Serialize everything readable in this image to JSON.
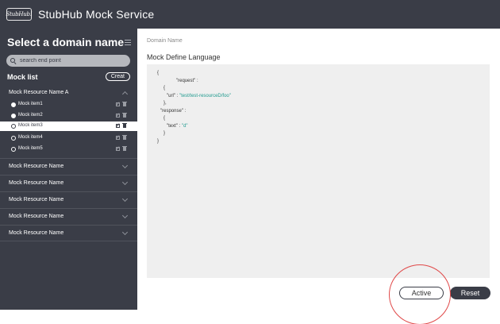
{
  "header": {
    "logo_text": "StubHub!",
    "app_title": "StubHub Mock Service"
  },
  "sidebar": {
    "title": "Select a domain name",
    "search_placeholder": "search end point",
    "mock_list_title": "Mock list",
    "create_label": "Creat",
    "resource_a": {
      "label": "Mock Resource Name A",
      "items": [
        {
          "label": "Mock item1",
          "checked": true,
          "active": false
        },
        {
          "label": "Mock item2",
          "checked": true,
          "active": false
        },
        {
          "label": "Mock item3",
          "checked": false,
          "active": true
        },
        {
          "label": "Mock item4",
          "checked": false,
          "active": false
        },
        {
          "label": "Mock item5",
          "checked": false,
          "active": false
        }
      ]
    },
    "resources": [
      {
        "label": "Mock Resource  Name"
      },
      {
        "label": "Mock Resource  Name"
      },
      {
        "label": "Mock Resource  Name"
      },
      {
        "label": "Mock Resource  Name"
      },
      {
        "label": "Mock Resource  Name"
      }
    ]
  },
  "main": {
    "domain_label": "Domain Name",
    "mdl_label": "Mock Define Language",
    "code_lines": [
      {
        "text": "{",
        "indent": 0
      },
      {
        "text": "\"request\" :",
        "indent": 3
      },
      {
        "text": "{",
        "indent": 1
      },
      {
        "text": "\"url\" : ",
        "value": "\"test/test-resourceD/foo\"",
        "indent": 1.5
      },
      {
        "text": "},",
        "indent": 1
      },
      {
        "text": "\"response\" :",
        "indent": 0.5
      },
      {
        "text": "{",
        "indent": 1
      },
      {
        "text": "\"text\" : ",
        "value": "\"d\"",
        "indent": 1.5
      },
      {
        "text": "}",
        "indent": 1
      },
      {
        "text": "}",
        "indent": 0
      }
    ]
  },
  "actions": {
    "active_label": "Active",
    "reset_label": "Reset"
  },
  "colors": {
    "dark": "#3a3d47",
    "accent_string": "#1f9a8e",
    "annotation": "#e04848"
  }
}
